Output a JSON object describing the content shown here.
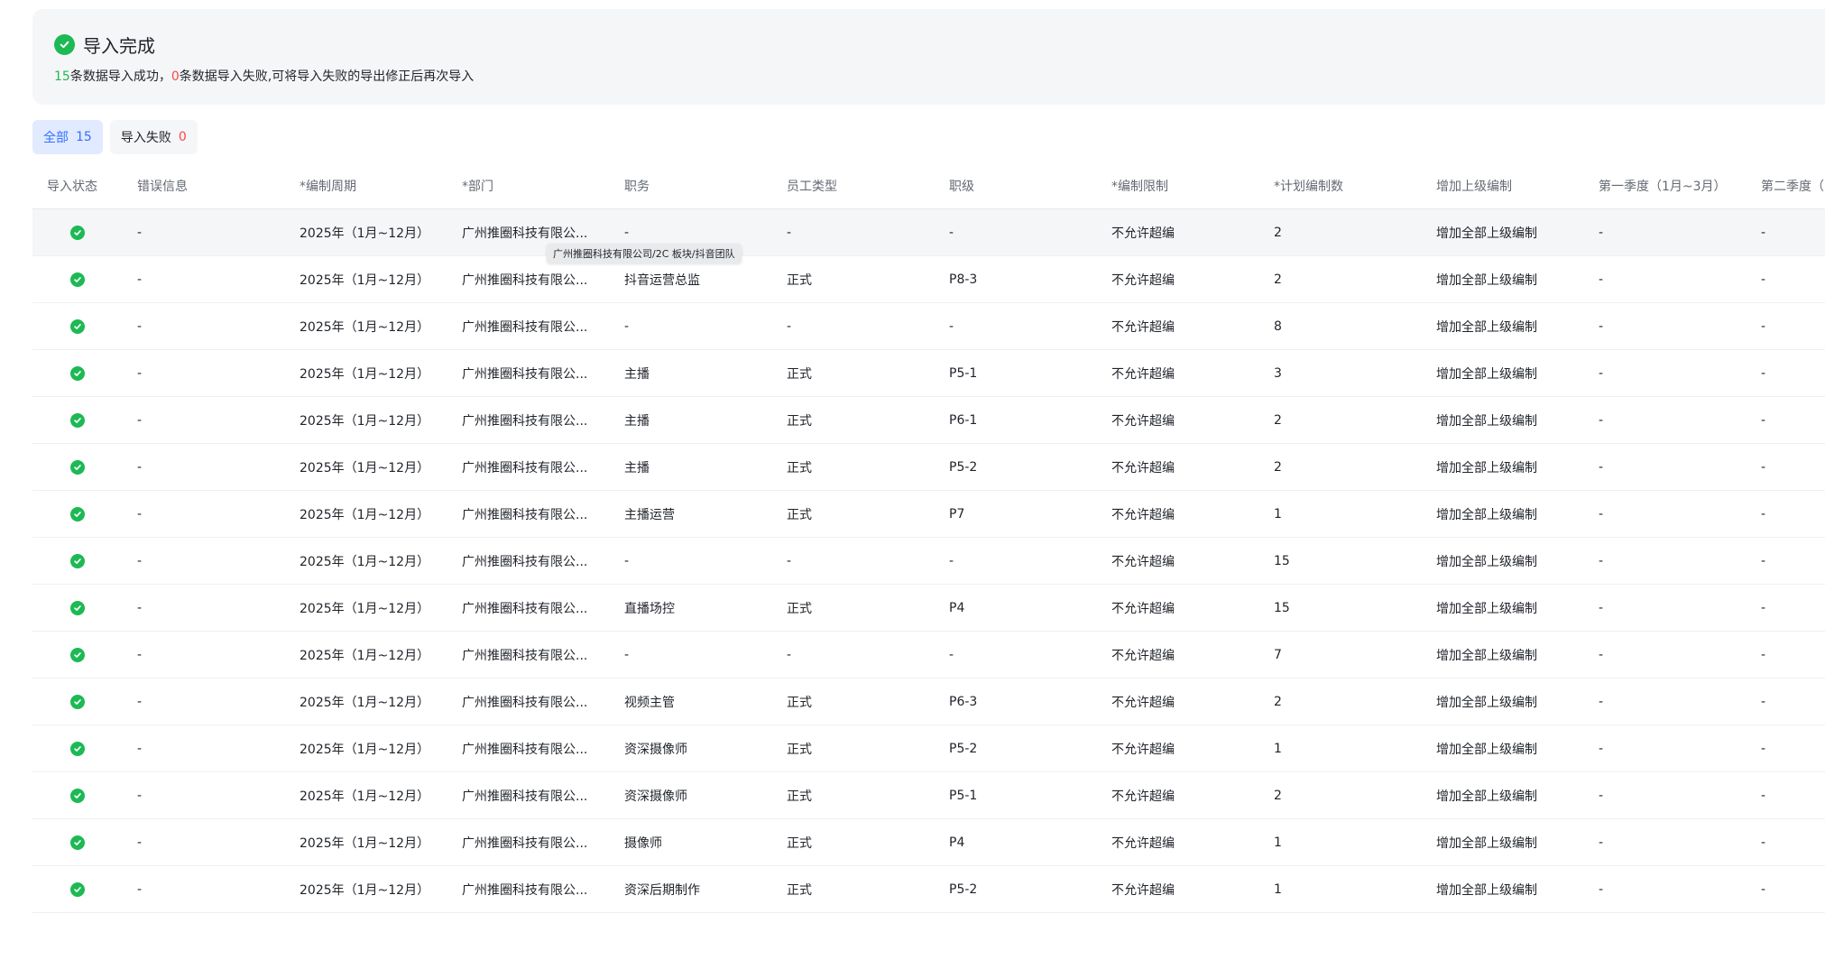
{
  "result": {
    "title": "导入完成",
    "success_count": "15",
    "success_text": "条数据导入成功，",
    "fail_count": "0",
    "fail_text": "条数据导入失败,可将导入失败的导出修正后再次导入"
  },
  "tabs": [
    {
      "label": "全部",
      "count": "15",
      "active": true
    },
    {
      "label": "导入失败",
      "count": "0",
      "active": false
    }
  ],
  "table": {
    "headers": [
      "导入状态",
      "错误信息",
      "*编制周期",
      "*部门",
      "职务",
      "员工类型",
      "职级",
      "*编制限制",
      "*计划编制数",
      "增加上级编制",
      "第一季度（1月~3月）",
      "第二季度（"
    ],
    "rows": [
      {
        "status": "success",
        "cells": [
          "-",
          "2025年（1月~12月）",
          "广州推圈科技有限公...",
          "-",
          "-",
          "-",
          "不允许超编",
          "2",
          "增加全部上级编制",
          "-",
          "-"
        ]
      },
      {
        "status": "success",
        "cells": [
          "-",
          "2025年（1月~12月）",
          "广州推圈科技有限公...",
          "抖音运营总监",
          "正式",
          "P8-3",
          "不允许超编",
          "2",
          "增加全部上级编制",
          "-",
          "-"
        ]
      },
      {
        "status": "success",
        "cells": [
          "-",
          "2025年（1月~12月）",
          "广州推圈科技有限公...",
          "-",
          "-",
          "-",
          "不允许超编",
          "8",
          "增加全部上级编制",
          "-",
          "-"
        ]
      },
      {
        "status": "success",
        "cells": [
          "-",
          "2025年（1月~12月）",
          "广州推圈科技有限公...",
          "主播",
          "正式",
          "P5-1",
          "不允许超编",
          "3",
          "增加全部上级编制",
          "-",
          "-"
        ]
      },
      {
        "status": "success",
        "cells": [
          "-",
          "2025年（1月~12月）",
          "广州推圈科技有限公...",
          "主播",
          "正式",
          "P6-1",
          "不允许超编",
          "2",
          "增加全部上级编制",
          "-",
          "-"
        ]
      },
      {
        "status": "success",
        "cells": [
          "-",
          "2025年（1月~12月）",
          "广州推圈科技有限公...",
          "主播",
          "正式",
          "P5-2",
          "不允许超编",
          "2",
          "增加全部上级编制",
          "-",
          "-"
        ]
      },
      {
        "status": "success",
        "cells": [
          "-",
          "2025年（1月~12月）",
          "广州推圈科技有限公...",
          "主播运营",
          "正式",
          "P7",
          "不允许超编",
          "1",
          "增加全部上级编制",
          "-",
          "-"
        ]
      },
      {
        "status": "success",
        "cells": [
          "-",
          "2025年（1月~12月）",
          "广州推圈科技有限公...",
          "-",
          "-",
          "-",
          "不允许超编",
          "15",
          "增加全部上级编制",
          "-",
          "-"
        ]
      },
      {
        "status": "success",
        "cells": [
          "-",
          "2025年（1月~12月）",
          "广州推圈科技有限公...",
          "直播场控",
          "正式",
          "P4",
          "不允许超编",
          "15",
          "增加全部上级编制",
          "-",
          "-"
        ]
      },
      {
        "status": "success",
        "cells": [
          "-",
          "2025年（1月~12月）",
          "广州推圈科技有限公...",
          "-",
          "-",
          "-",
          "不允许超编",
          "7",
          "增加全部上级编制",
          "-",
          "-"
        ]
      },
      {
        "status": "success",
        "cells": [
          "-",
          "2025年（1月~12月）",
          "广州推圈科技有限公...",
          "视频主管",
          "正式",
          "P6-3",
          "不允许超编",
          "2",
          "增加全部上级编制",
          "-",
          "-"
        ]
      },
      {
        "status": "success",
        "cells": [
          "-",
          "2025年（1月~12月）",
          "广州推圈科技有限公...",
          "资深摄像师",
          "正式",
          "P5-2",
          "不允许超编",
          "1",
          "增加全部上级编制",
          "-",
          "-"
        ]
      },
      {
        "status": "success",
        "cells": [
          "-",
          "2025年（1月~12月）",
          "广州推圈科技有限公...",
          "资深摄像师",
          "正式",
          "P5-1",
          "不允许超编",
          "2",
          "增加全部上级编制",
          "-",
          "-"
        ]
      },
      {
        "status": "success",
        "cells": [
          "-",
          "2025年（1月~12月）",
          "广州推圈科技有限公...",
          "摄像师",
          "正式",
          "P4",
          "不允许超编",
          "1",
          "增加全部上级编制",
          "-",
          "-"
        ]
      },
      {
        "status": "success",
        "cells": [
          "-",
          "2025年（1月~12月）",
          "广州推圈科技有限公...",
          "资深后期制作",
          "正式",
          "P5-2",
          "不允许超编",
          "1",
          "增加全部上级编制",
          "-",
          "-"
        ]
      }
    ]
  },
  "tooltip": {
    "text": "广州推圈科技有限公司/2C 板块/抖音团队"
  },
  "colors": {
    "success": "#1db954",
    "fail": "#f54a45",
    "accent": "#3370ff"
  },
  "icons": {
    "status": "check-circle-icon"
  }
}
